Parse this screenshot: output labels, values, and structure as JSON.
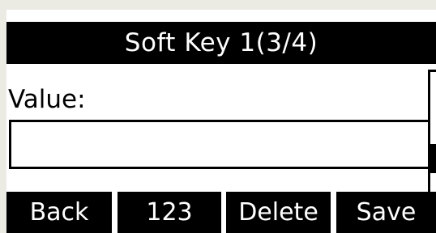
{
  "title": "Soft Key 1(3/4)",
  "field": {
    "label": "Value:",
    "value": ""
  },
  "softkeys": [
    {
      "label": "Back"
    },
    {
      "label": "123"
    },
    {
      "label": "Delete"
    },
    {
      "label": "Save"
    }
  ],
  "colors": {
    "background": "#ecebe3",
    "screen": "#ffffff",
    "bar": "#000000",
    "bar_text": "#ffffff"
  }
}
